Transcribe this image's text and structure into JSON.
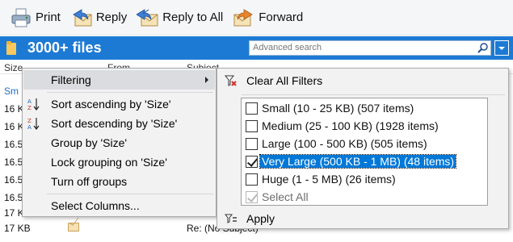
{
  "toolbar": {
    "print_label": "Print",
    "reply_label": "Reply",
    "reply_all_label": "Reply to All",
    "forward_label": "Forward"
  },
  "header": {
    "title": "3000+ files",
    "search_placeholder": "Advanced search"
  },
  "columns": {
    "size": "Size",
    "from": "From",
    "subject": "Subject"
  },
  "rows": [
    {
      "size": "Sm",
      "subject": ""
    },
    {
      "size": "16 KI",
      "subject": ""
    },
    {
      "size": "16 KI",
      "subject": ""
    },
    {
      "size": "16.5",
      "subject": ""
    },
    {
      "size": "16.5",
      "subject": ""
    },
    {
      "size": "16.5",
      "subject": ""
    },
    {
      "size": "16.5",
      "subject": ""
    },
    {
      "size": "17 KI",
      "subject": ""
    },
    {
      "size": "17 KB",
      "subject": "Re: (No Subject)"
    }
  ],
  "context_menu": {
    "filtering": "Filtering",
    "sort_asc": "Sort ascending by 'Size'",
    "sort_desc": "Sort descending by 'Size'",
    "group_by": "Group by 'Size'",
    "lock_grouping": "Lock grouping on 'Size'",
    "turn_off_groups": "Turn off groups",
    "select_columns": "Select Columns..."
  },
  "filter_submenu": {
    "clear_all": "Clear All Filters",
    "options": [
      {
        "label": "Small (10 - 25 KB) (507 items)",
        "checked": false
      },
      {
        "label": "Medium (25 - 100 KB) (1928 items)",
        "checked": false
      },
      {
        "label": "Large (100 - 500 KB) (505 items)",
        "checked": false
      },
      {
        "label": "Very Large (500 KB - 1 MB) (48 items)",
        "checked": true
      },
      {
        "label": "Huge (1 - 5 MB) (26 items)",
        "checked": false
      }
    ],
    "select_all": "Select All",
    "apply": "Apply"
  },
  "colors": {
    "header_blue": "#1d7ad4",
    "selection_blue": "#0078d7",
    "menu_bg": "#f2f2f2"
  }
}
